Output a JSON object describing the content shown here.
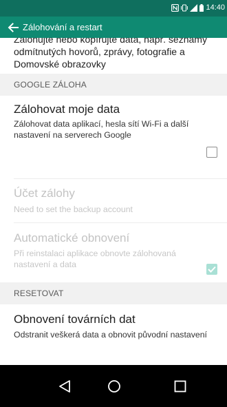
{
  "status_bar": {
    "time": "14:40",
    "icons": [
      "nfc-icon",
      "vibrate-icon",
      "signal-icon",
      "battery-icon"
    ],
    "background": "#0f6f5e"
  },
  "action_bar": {
    "title": "Zálohování a restart",
    "back_icon": "back-arrow-icon",
    "background": "#0f8a72"
  },
  "intro": {
    "text": "Zálohujte nebo kopírujte data, např. seznamy odmítnutých hovorů, zprávy, fotografie a Domovské obrazovky"
  },
  "sections": [
    {
      "header": "GOOGLE ZÁLOHA",
      "items": [
        {
          "title": "Zálohovat moje data",
          "summary": "Zálohovat data aplikací, hesla sítí Wi-Fi a další nastavení na serverech Google",
          "checked": false,
          "enabled": true
        },
        {
          "title": "Účet zálohy",
          "summary": "Need to set the backup account",
          "enabled": false
        },
        {
          "title": "Automatické obnovení",
          "summary": "Při reinstalaci aplikace obnovte zálohovaná nastavení a data",
          "checked": true,
          "enabled": false
        }
      ]
    },
    {
      "header": "RESETOVAT",
      "items": [
        {
          "title": "Obnovení továrních dat",
          "summary": "Odstranit veškerá data a obnovit původní nastavení",
          "enabled": true
        }
      ]
    }
  ],
  "nav_bar": {
    "buttons": [
      "back-triangle-icon",
      "home-circle-icon",
      "recents-square-icon"
    ]
  },
  "colors": {
    "accent": "#0f8a72",
    "checkbox_checked_disabled": "#a9e0d5",
    "section_header_bg": "#f1f1f1"
  }
}
